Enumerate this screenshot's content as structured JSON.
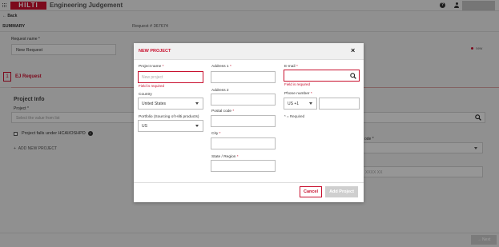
{
  "header": {
    "app_title": "Engineering Judgement",
    "logo_text": "HILTI",
    "help_icon": "help-icon",
    "user_icon": "user-icon"
  },
  "nav": {
    "back_label": "Back"
  },
  "summary": {
    "label": "SUMMARY",
    "request_number": "Request # 367674"
  },
  "request": {
    "name_label": "Request name",
    "name_value": "New Request",
    "status": "new"
  },
  "step": {
    "number": "1",
    "label": "EJ Request"
  },
  "project_info": {
    "heading": "Project Info",
    "project_label": "Project",
    "project_placeholder": "Select the value from list",
    "checkbox_label": "Project falls under HCAI/OSHPD",
    "add_new_label": "ADD NEW PROJECT",
    "right_select_label": "ode",
    "right_input_placeholder": "XXXX XX"
  },
  "footer": {
    "next_label": "Next"
  },
  "modal": {
    "title": "NEW PROJECT",
    "close_label": "×",
    "project_name": {
      "label": "Project name",
      "required": "*",
      "placeholder": "New project",
      "error": "Field is required"
    },
    "country": {
      "label": "Country",
      "value": "United States"
    },
    "portfolio": {
      "label": "Portfolio (Sourcing of Hilti products)",
      "value": "US"
    },
    "address1": {
      "label": "Address 1",
      "required": "*"
    },
    "address2": {
      "label": "Address 2"
    },
    "postal_code": {
      "label": "Postal code",
      "required": "*"
    },
    "city": {
      "label": "City",
      "required": "*"
    },
    "state": {
      "label": "State / Region",
      "required": "*"
    },
    "email": {
      "label": "E-mail",
      "required": "*",
      "error": "Field is required"
    },
    "phone": {
      "label": "Phone number",
      "required": "*",
      "country_code": "US +1"
    },
    "required_note": "* = Required",
    "cancel_label": "Cancel",
    "add_label": "Add Project"
  },
  "colors": {
    "brand_red": "#c8102e",
    "overlay": "rgba(0,0,0,0.38)"
  }
}
